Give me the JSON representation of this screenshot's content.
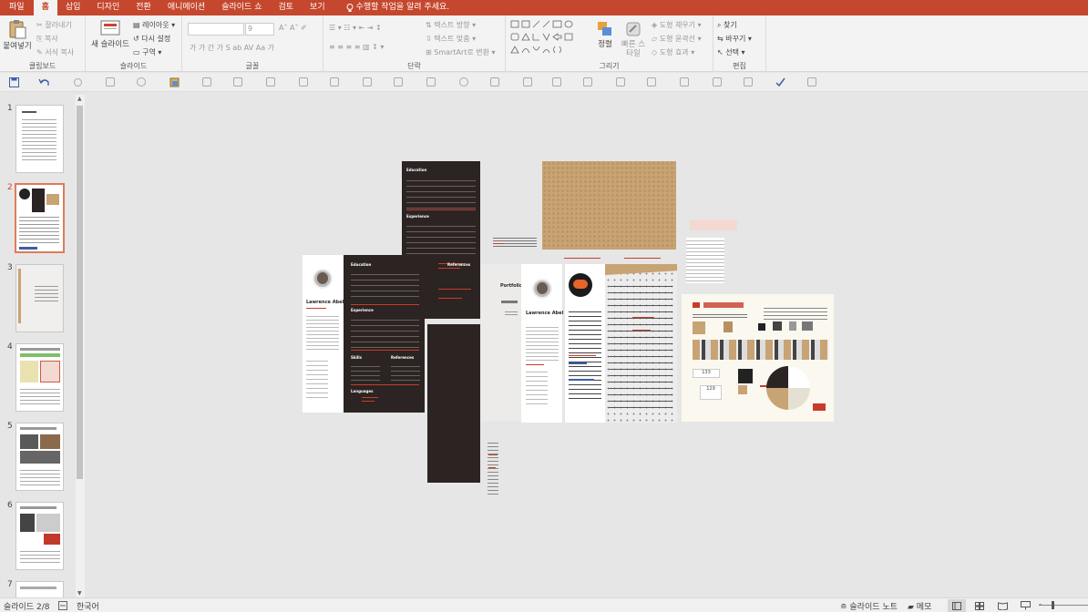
{
  "menu": {
    "tabs": [
      "파일",
      "홈",
      "삽입",
      "디자인",
      "전환",
      "애니메이션",
      "슬라이드 쇼",
      "검토",
      "보기"
    ],
    "active_tab": "홈",
    "tell_me": "수행할 작업을 알려 주세요."
  },
  "ribbon": {
    "clipboard": {
      "label": "클립보드",
      "paste": "붙여넣기",
      "cut": "잘라내기",
      "copy": "복사",
      "format_painter": "서식 복사"
    },
    "slides": {
      "label": "슬라이드",
      "new_slide": "새 슬라이드",
      "layout": "레이아웃",
      "reset": "다시 설정",
      "section": "구역"
    },
    "font": {
      "label": "글꼴",
      "size": "9"
    },
    "paragraph": {
      "label": "단락",
      "text_direction": "텍스트 방향",
      "align_text": "텍스트 맞춤",
      "smartart": "SmartArt로 변환"
    },
    "drawing": {
      "label": "그리기",
      "arrange": "정렬",
      "quick_styles": "빠른 스타일",
      "shape_fill": "도형 채우기",
      "shape_outline": "도형 윤곽선",
      "shape_effects": "도형 효과"
    },
    "editing": {
      "label": "편집",
      "find": "찾기",
      "replace": "바꾸기",
      "select": "선택"
    }
  },
  "thumbnails": [
    {
      "number": "1"
    },
    {
      "number": "2",
      "selected": true
    },
    {
      "number": "3"
    },
    {
      "number": "4"
    },
    {
      "number": "5"
    },
    {
      "number": "6"
    },
    {
      "number": "7"
    }
  ],
  "canvas": {
    "resume_name": "Lawrence Abel",
    "portfolio_title": "Portfolio",
    "sections": {
      "education": "Education",
      "experience": "Experience",
      "skills": "Skills",
      "references": "References",
      "languages": "Languages"
    }
  },
  "status": {
    "slide": "슬라이드 2/8",
    "language": "한국어",
    "notes": "슬라이드 노트",
    "comments": "메모"
  },
  "colors": {
    "accent": "#c5472d",
    "dark_panel": "#2b2422",
    "kraft": "#c8a374"
  }
}
